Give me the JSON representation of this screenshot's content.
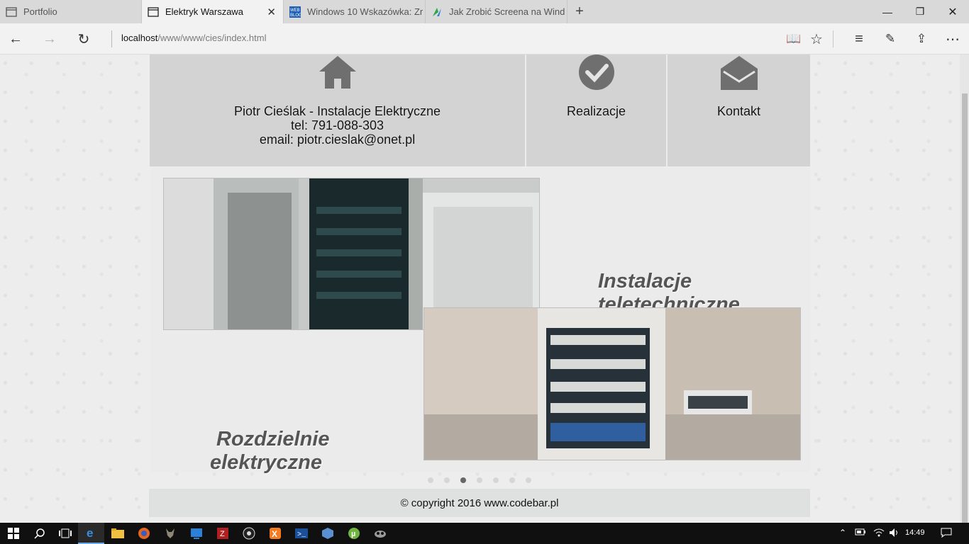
{
  "browser": {
    "tabs": [
      {
        "title": "Portfolio",
        "active": false
      },
      {
        "title": "Elektryk Warszawa",
        "active": true
      },
      {
        "title": "Windows 10 Wskazówka: Zr",
        "active": false
      },
      {
        "title": "Jak Zrobić Screena na Wind",
        "active": false
      }
    ],
    "url_host": "localhost",
    "url_path": "/www/www/cies/index.html"
  },
  "site": {
    "header": {
      "company": "Piotr Cieślak - Instalacje Elektryczne",
      "phone": "tel: 791-088-303",
      "email": "email: piotr.cieslak@onet.pl",
      "nav_realizacje": "Realizacje",
      "nav_kontakt": "Kontakt"
    },
    "slider": {
      "caption_top_line1": "Instalacje",
      "caption_top_line2": "teletechniczne",
      "caption_bottom_line1": "Rozdzielnie",
      "caption_bottom_line2": "elektryczne",
      "dots_count": 7,
      "active_dot": 3
    },
    "footer": "© copyright 2016 www.codebar.pl"
  },
  "taskbar": {
    "clock": "14:49"
  }
}
